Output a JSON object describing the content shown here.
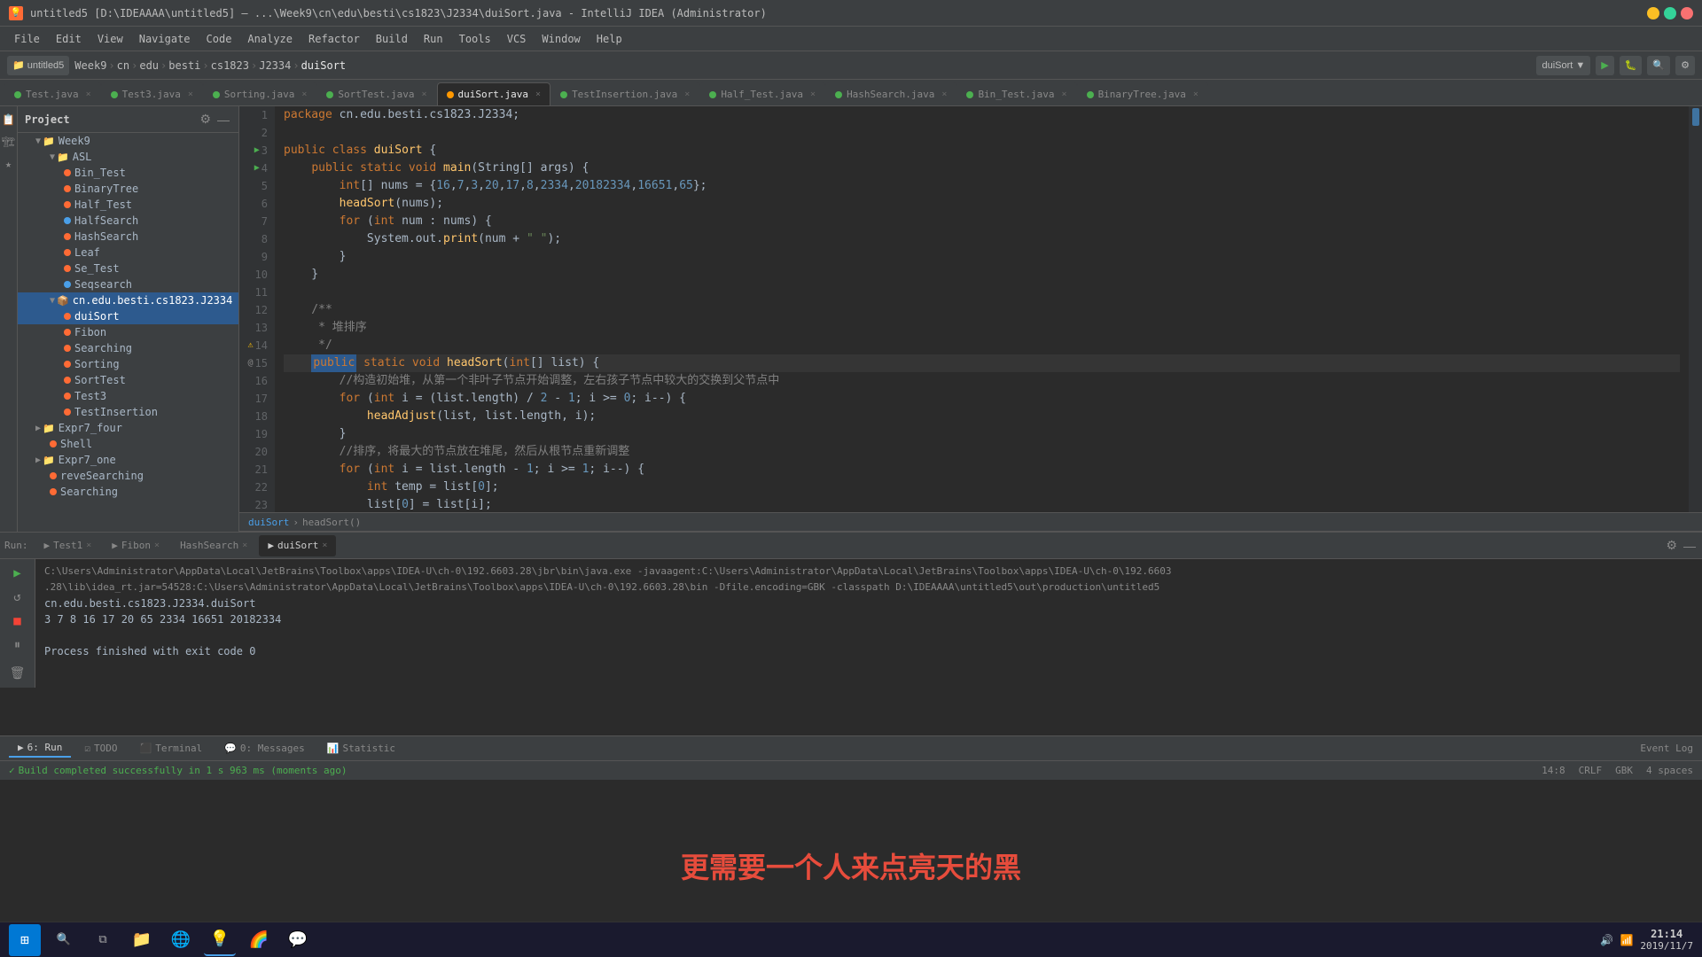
{
  "titlebar": {
    "title": "untitled5 [D:\\IDEAAAA\\untitled5] – ...\\Week9\\cn\\edu\\besti\\cs1823\\J2334\\duiSort.java - IntelliJ IDEA (Administrator)",
    "app": "IntelliJ IDEA"
  },
  "menubar": {
    "items": [
      "File",
      "Edit",
      "View",
      "Navigate",
      "Code",
      "Analyze",
      "Refactor",
      "Build",
      "Run",
      "Tools",
      "VCS",
      "Window",
      "Help"
    ]
  },
  "navbar": {
    "project": "untitled5",
    "breadcrumb": [
      "Week9",
      "cn",
      "edu",
      "besti",
      "cs1823",
      "J2334",
      "duiSort"
    ],
    "run_config": "duiSort"
  },
  "tabs": [
    {
      "label": "Test.java",
      "active": false,
      "dot": "green"
    },
    {
      "label": "Test3.java",
      "active": false,
      "dot": "green"
    },
    {
      "label": "Sorting.java",
      "active": false,
      "dot": "green"
    },
    {
      "label": "SortTest.java",
      "active": false,
      "dot": "green"
    },
    {
      "label": "duiSort.java",
      "active": true,
      "dot": "orange"
    },
    {
      "label": "TestInsertion.java",
      "active": false,
      "dot": "green"
    },
    {
      "label": "Half_Test.java",
      "active": false,
      "dot": "green"
    },
    {
      "label": "HashSearch.java",
      "active": false,
      "dot": "green"
    },
    {
      "label": "Bin_Test.java",
      "active": false,
      "dot": "green"
    },
    {
      "label": "BinaryTree.java",
      "active": false,
      "dot": "green"
    }
  ],
  "sidebar": {
    "title": "Project",
    "tree": [
      {
        "label": "Week9",
        "type": "folder",
        "depth": 1,
        "expanded": true
      },
      {
        "label": "ASL",
        "type": "folder",
        "depth": 2,
        "expanded": true
      },
      {
        "label": "Bin_Test",
        "type": "java",
        "depth": 3,
        "color": "orange"
      },
      {
        "label": "BinaryTree",
        "type": "java",
        "depth": 3,
        "color": "orange"
      },
      {
        "label": "Half_Test",
        "type": "java",
        "depth": 3,
        "color": "orange"
      },
      {
        "label": "HalfSearch",
        "type": "java",
        "depth": 3,
        "color": "blue"
      },
      {
        "label": "HashSearch",
        "type": "java",
        "depth": 3,
        "color": "orange"
      },
      {
        "label": "Leaf",
        "type": "java",
        "depth": 3,
        "color": "orange"
      },
      {
        "label": "Se_Test",
        "type": "java",
        "depth": 3,
        "color": "orange"
      },
      {
        "label": "Seqsearch",
        "type": "java",
        "depth": 3,
        "color": "blue"
      },
      {
        "label": "cn.edu.besti.cs1823.J2334",
        "type": "folder",
        "depth": 2,
        "expanded": true,
        "selected": true
      },
      {
        "label": "duiSort",
        "type": "java",
        "depth": 3,
        "color": "orange",
        "selected": true
      },
      {
        "label": "Fibon",
        "type": "java",
        "depth": 3,
        "color": "orange"
      },
      {
        "label": "Searching",
        "type": "java",
        "depth": 3,
        "color": "orange"
      },
      {
        "label": "Sorting",
        "type": "java",
        "depth": 3,
        "color": "orange"
      },
      {
        "label": "SortTest",
        "type": "java",
        "depth": 3,
        "color": "orange"
      },
      {
        "label": "Test3",
        "type": "java",
        "depth": 3,
        "color": "orange"
      },
      {
        "label": "TestInsertion",
        "type": "java",
        "depth": 3,
        "color": "orange"
      },
      {
        "label": "Expr7_four",
        "type": "folder",
        "depth": 1,
        "expanded": false
      },
      {
        "label": "Shell",
        "type": "java",
        "depth": 2,
        "color": "orange"
      },
      {
        "label": "Expr7_one",
        "type": "folder",
        "depth": 1,
        "expanded": false
      },
      {
        "label": "reveSearching",
        "type": "java",
        "depth": 2,
        "color": "orange"
      },
      {
        "label": "Searching",
        "type": "java",
        "depth": 2,
        "color": "orange"
      }
    ]
  },
  "editor": {
    "filename": "duiSort.java",
    "breadcrumb": "duiSort > headSort()",
    "lines": [
      {
        "num": 1,
        "content": "package cn.edu.besti.cs1823.J2334;"
      },
      {
        "num": 2,
        "content": ""
      },
      {
        "num": 3,
        "content": "public class duiSort {",
        "has_run": true
      },
      {
        "num": 4,
        "content": "    public static void main(String[] args) {",
        "has_run": true
      },
      {
        "num": 5,
        "content": "        int[] nums = {16,7,3,20,17,8,2334,20182334,16651,65};"
      },
      {
        "num": 6,
        "content": "        headSort(nums);"
      },
      {
        "num": 7,
        "content": "        for (int num : nums) {"
      },
      {
        "num": 8,
        "content": "            System.out.print(num + \" \");"
      },
      {
        "num": 9,
        "content": "        }"
      },
      {
        "num": 10,
        "content": "    }"
      },
      {
        "num": 11,
        "content": ""
      },
      {
        "num": 12,
        "content": "    /**"
      },
      {
        "num": 13,
        "content": "     * 堆排序"
      },
      {
        "num": 14,
        "content": "     */",
        "has_warning": true
      },
      {
        "num": 15,
        "content": "    public static void headSort(int[] list) {",
        "has_annotation": true
      },
      {
        "num": 16,
        "content": "        //构造初始堆，从第一个非叶子节点开始调整，左右孩子节点中较大的交换到父节点中"
      },
      {
        "num": 17,
        "content": "        for (int i = (list.length) / 2 - 1; i >= 0; i--) {"
      },
      {
        "num": 18,
        "content": "            headAdjust(list, list.length, i);"
      },
      {
        "num": 19,
        "content": "        }"
      },
      {
        "num": 20,
        "content": "        //排序，将最大的节点放在堆尾，然后从根节点重新调整"
      },
      {
        "num": 21,
        "content": "        for (int i = list.length - 1; i >= 1; i--) {"
      },
      {
        "num": 22,
        "content": "            int temp = list[0];"
      },
      {
        "num": 23,
        "content": "            list[0] = list[i];"
      }
    ]
  },
  "run_panel": {
    "tabs": [
      {
        "label": "Run: Test1",
        "active": false
      },
      {
        "label": "Fibon",
        "active": false
      },
      {
        "label": "HashSearch",
        "active": false
      },
      {
        "label": "duiSort",
        "active": true
      }
    ],
    "output": [
      "C:\\Users\\Administrator\\AppData\\Local\\JetBrains\\Toolbox\\apps\\IDEA-U\\ch-0\\192.6603.28\\jbr\\bin\\java.exe -javaagent:C:\\Users\\Administrator\\AppData\\Local\\JetBrains\\Toolbox\\apps\\IDEA-U\\ch-0\\192.6603",
      ".28\\lib\\idea_rt.jar=54528:C:\\Users\\Administrator\\AppData\\Local\\JetBrains\\Toolbox\\apps\\IDEA-U\\ch-0\\192.6603.28\\bin -Dfile.encoding=GBK -classpath D:\\IDEAAAA\\untitled5\\out\\production\\untitled5",
      "cn.edu.besti.cs1823.J2334.duiSort",
      "3 7 8 16 17 20 65 2334 16651 20182334",
      "",
      "Process finished with exit code 0"
    ]
  },
  "bottom_tabs": [
    {
      "label": "6: Run",
      "active": false,
      "icon": "▶"
    },
    {
      "label": "TODO",
      "active": false,
      "icon": "☑"
    },
    {
      "label": "Terminal",
      "active": false,
      "icon": "⬛"
    },
    {
      "label": "0: Messages",
      "active": false,
      "icon": "💬"
    },
    {
      "label": "Statistic",
      "active": false,
      "icon": "📊"
    }
  ],
  "status_bar": {
    "build_status": "Build completed successfully in 1 s 963 ms (moments ago)",
    "position": "14:8",
    "encoding": "CRLF",
    "charset": "GBK",
    "indent": "4 spaces",
    "event_log": "Event Log"
  },
  "watermark": {
    "text": "更需要一个人来点亮天的黑"
  },
  "taskbar": {
    "time": "21:14",
    "date": "2019/11/7"
  }
}
